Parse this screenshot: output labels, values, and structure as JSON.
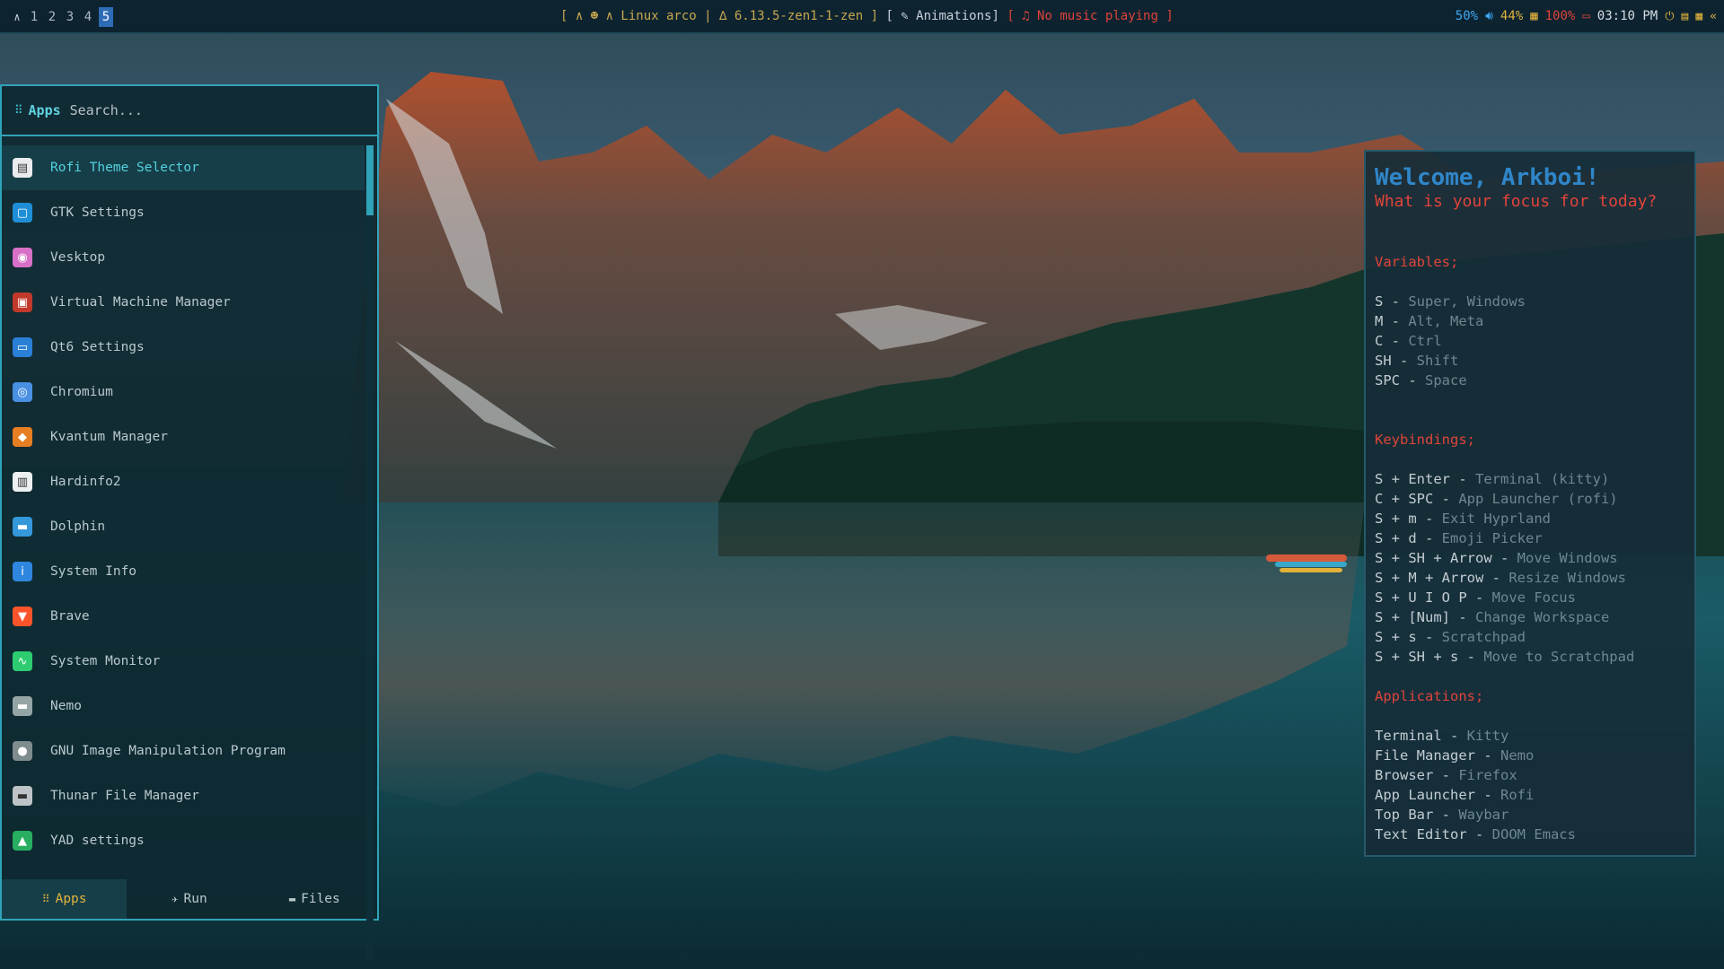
{
  "topbar": {
    "workspaces": [
      "1",
      "2",
      "3",
      "4",
      "5"
    ],
    "active_workspace": "5",
    "status_center": "[ ∧ ☻ ∧ Linux arco | ∆ 6.13.5-zen1-1-zen ]",
    "animations": "[ ✎ Animations]",
    "music": "[ ♫ No music playing ]",
    "volume": "50%",
    "cpu": "44%",
    "battery": "100%",
    "clock": "03:10 PM"
  },
  "rofi": {
    "mode_label": "Apps",
    "search_placeholder": "Search...",
    "items": [
      {
        "label": "Rofi Theme Selector",
        "icon": "theme-selector-icon",
        "color": "#e9ecef"
      },
      {
        "label": "GTK Settings",
        "icon": "gtk-settings-icon",
        "color": "#1e8fd6"
      },
      {
        "label": "Vesktop",
        "icon": "vesktop-icon",
        "color": "#d870c8"
      },
      {
        "label": "Virtual Machine Manager",
        "icon": "virt-manager-icon",
        "color": "#c0392b"
      },
      {
        "label": "Qt6 Settings",
        "icon": "qt-settings-icon",
        "color": "#2a7fd6"
      },
      {
        "label": "Chromium",
        "icon": "chromium-icon",
        "color": "#4a90e2"
      },
      {
        "label": "Kvantum Manager",
        "icon": "kvantum-icon",
        "color": "#e67e22"
      },
      {
        "label": "Hardinfo2",
        "icon": "hardinfo-icon",
        "color": "#ecf0f1"
      },
      {
        "label": "Dolphin",
        "icon": "dolphin-icon",
        "color": "#3498db"
      },
      {
        "label": "System Info",
        "icon": "system-info-icon",
        "color": "#2e86de"
      },
      {
        "label": "Brave",
        "icon": "brave-icon",
        "color": "#fb542b"
      },
      {
        "label": "System Monitor",
        "icon": "system-monitor-icon",
        "color": "#2ecc71"
      },
      {
        "label": "Nemo",
        "icon": "nemo-icon",
        "color": "#95a5a6"
      },
      {
        "label": "GNU Image Manipulation Program",
        "icon": "gimp-icon",
        "color": "#7f8c8d"
      },
      {
        "label": "Thunar File Manager",
        "icon": "thunar-icon",
        "color": "#bdc3c7"
      },
      {
        "label": "YAD settings",
        "icon": "yad-icon",
        "color": "#27ae60"
      }
    ],
    "modes": [
      {
        "label": "Apps",
        "icon": "apps-grid-icon"
      },
      {
        "label": "Run",
        "icon": "run-icon"
      },
      {
        "label": "Files",
        "icon": "folder-icon"
      }
    ]
  },
  "welcome": {
    "greeting": "Welcome, Arkboi!",
    "prompt": "What is your focus for today?",
    "variables_title": "Variables;",
    "variables": [
      {
        "key": "S",
        "value": "Super, Windows"
      },
      {
        "key": "M",
        "value": "Alt, Meta"
      },
      {
        "key": "C",
        "value": "Ctrl"
      },
      {
        "key": "SH",
        "value": "Shift"
      },
      {
        "key": "SPC",
        "value": "Space"
      }
    ],
    "keybindings_title": "Keybindings;",
    "keybindings": [
      {
        "key": "S + Enter",
        "value": "Terminal (kitty)"
      },
      {
        "key": "C + SPC",
        "value": "App Launcher (rofi)"
      },
      {
        "key": "S + m",
        "value": "Exit Hyprland"
      },
      {
        "key": "S + d",
        "value": "Emoji Picker"
      },
      {
        "key": "S + SH + Arrow",
        "value": "Move Windows"
      },
      {
        "key": "S + M + Arrow",
        "value": "Resize Windows"
      },
      {
        "key": "S + U I O P",
        "value": "Move Focus"
      },
      {
        "key": "S + [Num]",
        "value": "Change Workspace"
      },
      {
        "key": "S + s",
        "value": "Scratchpad"
      },
      {
        "key": "S + SH + s",
        "value": "Move to Scratchpad"
      }
    ],
    "applications_title": "Applications;",
    "applications": [
      {
        "key": "Terminal",
        "value": "Kitty"
      },
      {
        "key": "File Manager",
        "value": "Nemo"
      },
      {
        "key": "Browser",
        "value": "Firefox"
      },
      {
        "key": "App Launcher",
        "value": "Rofi"
      },
      {
        "key": "Top Bar",
        "value": "Waybar"
      },
      {
        "key": "Text Editor",
        "value": " DOOM Emacs"
      }
    ]
  }
}
